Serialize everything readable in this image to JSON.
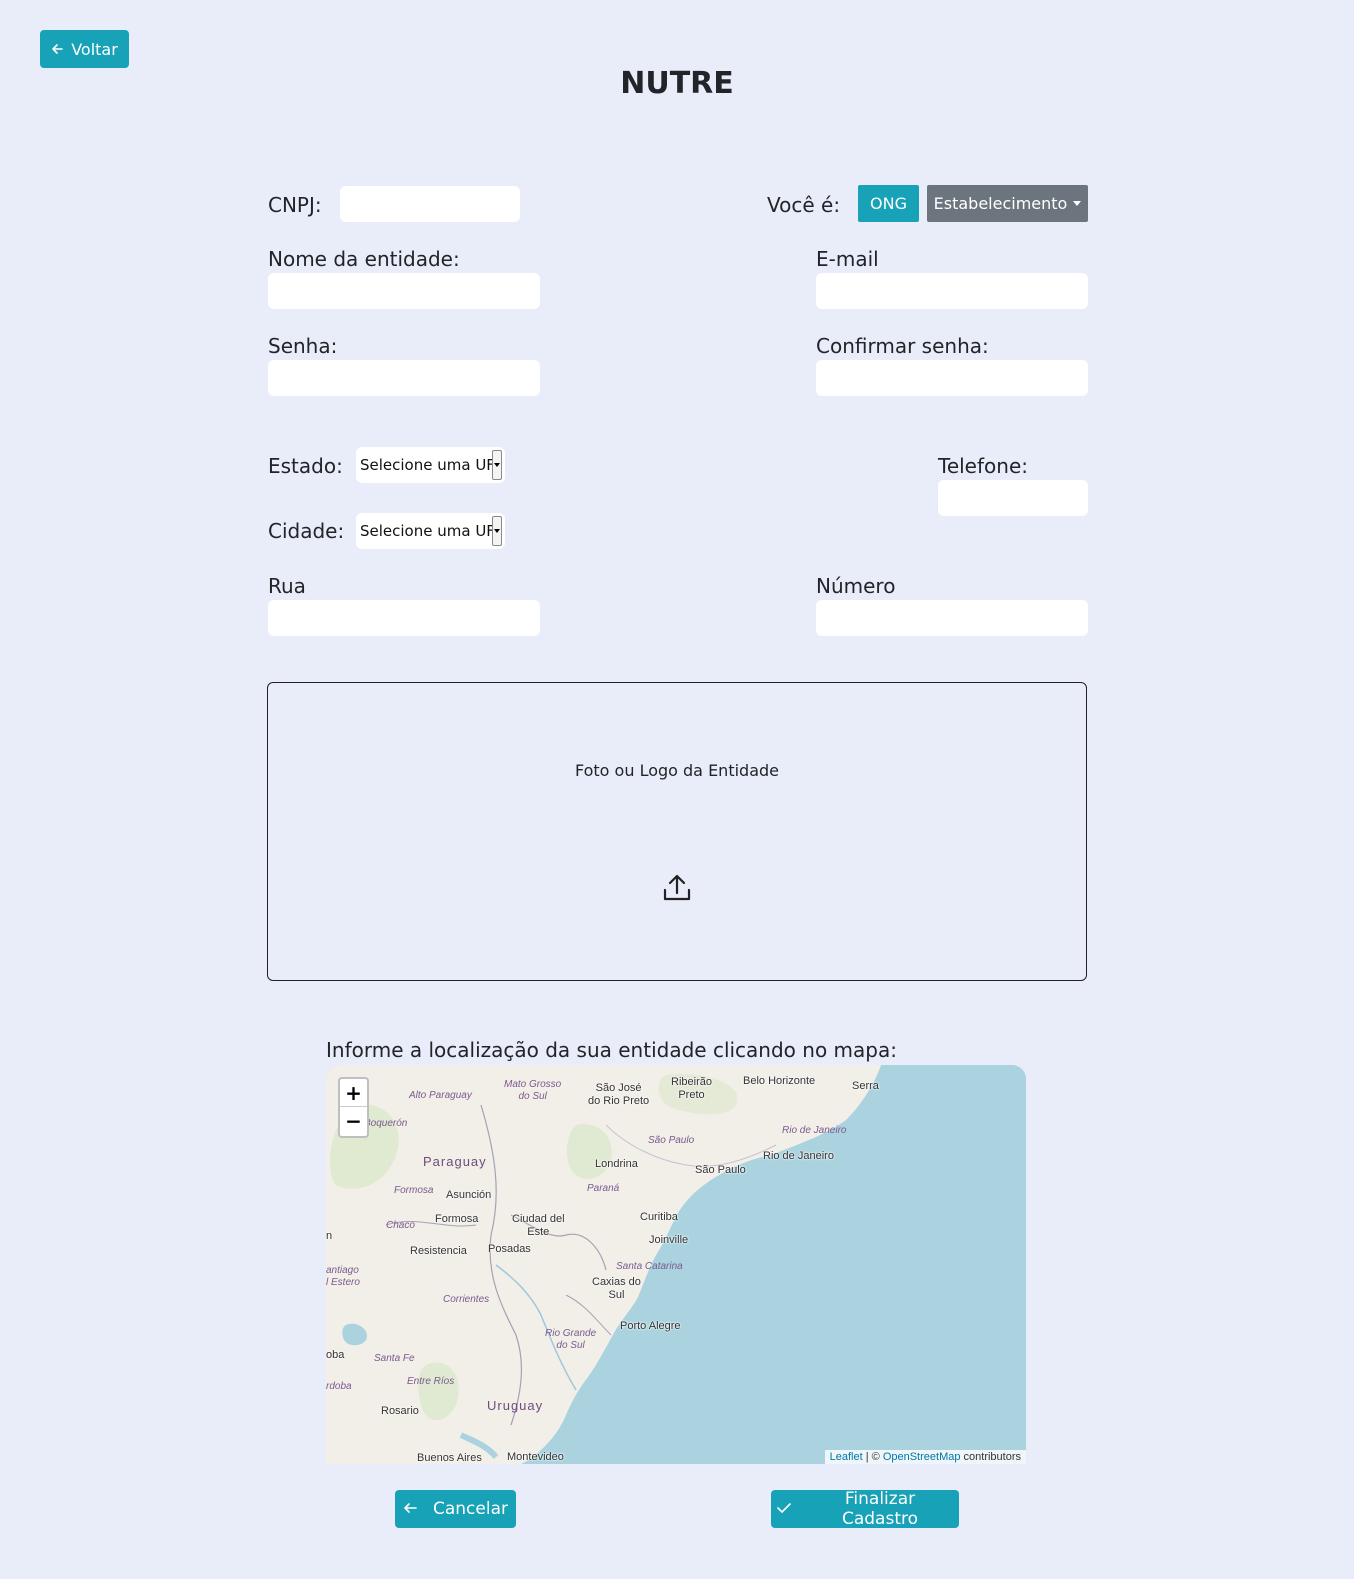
{
  "header": {
    "back_label": "Voltar",
    "title": "NUTRE"
  },
  "form": {
    "cnpj_label": "CNPJ:",
    "cnpj_value": "",
    "type_label": "Você é:",
    "type_options": {
      "ong": "ONG",
      "establishment": "Estabelecimento"
    },
    "name_label": "Nome da entidade:",
    "email_label": "E-mail",
    "password_label": "Senha:",
    "confirm_password_label": "Confirmar senha:",
    "state_label": "Estado:",
    "state_value": "Selecione uma UF",
    "city_label": "Cidade:",
    "city_value": "Selecione uma UF",
    "phone_label": "Telefone:",
    "street_label": "Rua",
    "number_label": "Número"
  },
  "upload": {
    "label": "Foto ou Logo da Entidade",
    "icon": "upload-icon"
  },
  "map": {
    "label": "Informe a localização da sua entidade clicando no mapa:",
    "zoom_in": "+",
    "zoom_out": "−",
    "attribution_leaflet": "Leaflet",
    "attribution_sep": " | © ",
    "attribution_osm": "OpenStreetMap",
    "attribution_suffix": " contributors",
    "places": {
      "alto_paraguay": "Alto Paraguay",
      "mato_grosso": "Mato Grosso\ndo Sul",
      "sao_jose": "São José\ndo Rio Preto",
      "ribeirao": "Ribeirão\nPreto",
      "belo_horizonte": "Belo Horizonte",
      "serra": "Serra",
      "boqueron": "Boquerón",
      "sao_paulo_state": "São Paulo",
      "rio_state": "Rio de Janeiro",
      "rio_city": "Rio de Janeiro",
      "paraguay": "Paraguay",
      "londrina": "Londrina",
      "sao_paulo_city": "São Paulo",
      "formosa_region": "Formosa",
      "asuncion": "Asunción",
      "parana": "Paraná",
      "chaco": "Chaco",
      "formosa_city": "Formosa",
      "ciudad_del_este": "Ciudad del\nEste",
      "curitiba": "Curitiba",
      "joinville": "Joinville",
      "resistencia": "Resistencia",
      "posadas": "Posadas",
      "santiago": "antiago\nl Estero",
      "santa_catarina": "Santa Catarina",
      "caxias": "Caxias do\nSul",
      "corrientes": "Corrientes",
      "porto_alegre": "Porto Alegre",
      "rio_grande": "Rio Grande\ndo Sul",
      "oba": "oba",
      "santa_fe": "Santa Fe",
      "rdoba": "rdoba",
      "entre_rios": "Entre Ríos",
      "uruguay": "Uruguay",
      "rosario": "Rosario",
      "buenos_aires": "Buenos Aires",
      "montevideo": "Montevideo",
      "n": "n"
    }
  },
  "actions": {
    "cancel_label": "Cancelar",
    "finish_label": "Finalizar Cadastro"
  },
  "colors": {
    "background": "#e9ecf9",
    "accent": "#17a2b8",
    "secondary": "#6c757d",
    "sea": "#aad3df",
    "land": "#f2efe9"
  }
}
